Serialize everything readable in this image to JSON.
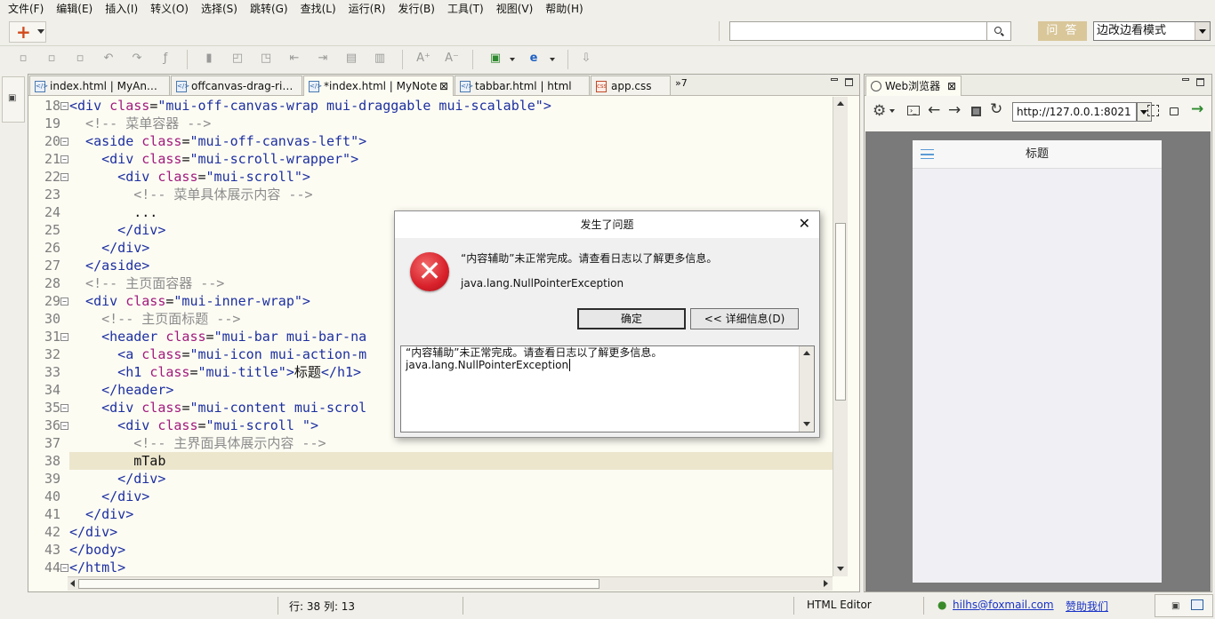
{
  "menu": [
    "文件(F)",
    "编辑(E)",
    "插入(I)",
    "转义(O)",
    "选择(S)",
    "跳转(G)",
    "查找(L)",
    "运行(R)",
    "发行(B)",
    "工具(T)",
    "视图(V)",
    "帮助(H)"
  ],
  "toolbar": {
    "search_value": "",
    "ask_label": "问 答",
    "mode_label": "边改边看模式"
  },
  "editor": {
    "tabs": [
      {
        "label": "index.html | MyAn…",
        "close": ""
      },
      {
        "label": "offcanvas-drag-ri…",
        "close": ""
      },
      {
        "label": "*index.html | MyNote",
        "close": "⊠"
      },
      {
        "label": "tabbar.html | html",
        "close": ""
      },
      {
        "label": "app.css",
        "close": ""
      }
    ],
    "overflow_label": "»7",
    "lines": [
      {
        "n": "18",
        "fold": true,
        "parts": [
          [
            "tg",
            "<div "
          ],
          [
            "at",
            "class"
          ],
          [
            "tx",
            "="
          ],
          [
            "sv",
            "\"mui-off-canvas-wrap mui-draggable mui-scalable\""
          ],
          [
            "tg",
            ">"
          ]
        ]
      },
      {
        "n": "19",
        "fold": false,
        "parts": [
          [
            "cm",
            "  <!-- 菜单容器 -->"
          ]
        ]
      },
      {
        "n": "20",
        "fold": true,
        "parts": [
          [
            "tg",
            "  <aside "
          ],
          [
            "at",
            "class"
          ],
          [
            "tx",
            "="
          ],
          [
            "sv",
            "\"mui-off-canvas-left\""
          ],
          [
            "tg",
            ">"
          ]
        ]
      },
      {
        "n": "21",
        "fold": true,
        "parts": [
          [
            "tg",
            "    <div "
          ],
          [
            "at",
            "class"
          ],
          [
            "tx",
            "="
          ],
          [
            "sv",
            "\"mui-scroll-wrapper\""
          ],
          [
            "tg",
            ">"
          ]
        ]
      },
      {
        "n": "22",
        "fold": true,
        "parts": [
          [
            "tg",
            "      <div "
          ],
          [
            "at",
            "class"
          ],
          [
            "tx",
            "="
          ],
          [
            "sv",
            "\"mui-scroll\""
          ],
          [
            "tg",
            ">"
          ]
        ]
      },
      {
        "n": "23",
        "fold": false,
        "parts": [
          [
            "cm",
            "        <!-- 菜单具体展示内容 -->"
          ]
        ]
      },
      {
        "n": "24",
        "fold": false,
        "parts": [
          [
            "tx",
            "        ..."
          ]
        ]
      },
      {
        "n": "25",
        "fold": false,
        "parts": [
          [
            "tg",
            "      </div>"
          ]
        ]
      },
      {
        "n": "26",
        "fold": false,
        "parts": [
          [
            "tg",
            "    </div>"
          ]
        ]
      },
      {
        "n": "27",
        "fold": false,
        "parts": [
          [
            "tg",
            "  </aside>"
          ]
        ]
      },
      {
        "n": "28",
        "fold": false,
        "parts": [
          [
            "cm",
            "  <!-- 主页面容器 -->"
          ]
        ]
      },
      {
        "n": "29",
        "fold": true,
        "parts": [
          [
            "tg",
            "  <div "
          ],
          [
            "at",
            "class"
          ],
          [
            "tx",
            "="
          ],
          [
            "sv",
            "\"mui-inner-wrap\""
          ],
          [
            "tg",
            ">"
          ]
        ]
      },
      {
        "n": "30",
        "fold": false,
        "parts": [
          [
            "cm",
            "    <!-- 主页面标题 -->"
          ]
        ]
      },
      {
        "n": "31",
        "fold": true,
        "parts": [
          [
            "tg",
            "    <header "
          ],
          [
            "at",
            "class"
          ],
          [
            "tx",
            "="
          ],
          [
            "sv",
            "\"mui-bar mui-bar-na"
          ]
        ]
      },
      {
        "n": "32",
        "fold": false,
        "parts": [
          [
            "tg",
            "      <a "
          ],
          [
            "at",
            "class"
          ],
          [
            "tx",
            "="
          ],
          [
            "sv",
            "\"mui-icon mui-action-m"
          ]
        ]
      },
      {
        "n": "33",
        "fold": false,
        "parts": [
          [
            "tg",
            "      <h1 "
          ],
          [
            "at",
            "class"
          ],
          [
            "tx",
            "="
          ],
          [
            "sv",
            "\"mui-title\""
          ],
          [
            "tg",
            ">"
          ],
          [
            "tx",
            "标题"
          ],
          [
            "tg",
            "</h1>"
          ]
        ]
      },
      {
        "n": "34",
        "fold": false,
        "parts": [
          [
            "tg",
            "    </header>"
          ]
        ]
      },
      {
        "n": "35",
        "fold": true,
        "parts": [
          [
            "tg",
            "    <div "
          ],
          [
            "at",
            "class"
          ],
          [
            "tx",
            "="
          ],
          [
            "sv",
            "\"mui-content mui-scrol"
          ]
        ]
      },
      {
        "n": "36",
        "fold": true,
        "parts": [
          [
            "tg",
            "      <div "
          ],
          [
            "at",
            "class"
          ],
          [
            "tx",
            "="
          ],
          [
            "sv",
            "\"mui-scroll \""
          ],
          [
            "tg",
            ">"
          ]
        ]
      },
      {
        "n": "37",
        "fold": false,
        "parts": [
          [
            "cm",
            "        <!-- 主界面具体展示内容 -->"
          ]
        ]
      },
      {
        "n": "38",
        "fold": false,
        "parts": [
          [
            "tx",
            "        mTab"
          ]
        ]
      },
      {
        "n": "39",
        "fold": false,
        "parts": [
          [
            "tg",
            "      </div>"
          ]
        ]
      },
      {
        "n": "40",
        "fold": false,
        "parts": [
          [
            "tg",
            "    </div>"
          ]
        ]
      },
      {
        "n": "41",
        "fold": false,
        "parts": [
          [
            "tg",
            "  </div>"
          ]
        ]
      },
      {
        "n": "42",
        "fold": false,
        "parts": [
          [
            "tg",
            "</div>"
          ]
        ]
      },
      {
        "n": "43",
        "fold": false,
        "parts": [
          [
            "tg",
            "</body>"
          ]
        ]
      },
      {
        "n": "44",
        "fold": true,
        "parts": [
          [
            "tg",
            "</html>"
          ]
        ]
      }
    ],
    "current_line": "38"
  },
  "browser": {
    "tab_label": "Web浏览器",
    "url": "http://127.0.0.1:8021",
    "phone_title": "标题"
  },
  "dialog": {
    "title": "发生了问题",
    "message": "“内容辅助”未正常完成。请查看日志以了解更多信息。",
    "exception": "java.lang.NullPointerException",
    "ok_label": "确定",
    "details_label": "<< 详细信息(D)",
    "details_line1": "“内容辅助”未正常完成。请查看日志以了解更多信息。",
    "details_line2": "java.lang.NullPointerException"
  },
  "status": {
    "position": "行: 38 列: 13",
    "mode": "HTML Editor",
    "email": "hilhs@foxmail.com",
    "donate": "赞助我们"
  },
  "colors": {
    "error_red": "#d8202a",
    "link_blue": "#1a33c8",
    "tag_blue": "#1c2fa0",
    "attr_purple": "#a01a7c"
  }
}
